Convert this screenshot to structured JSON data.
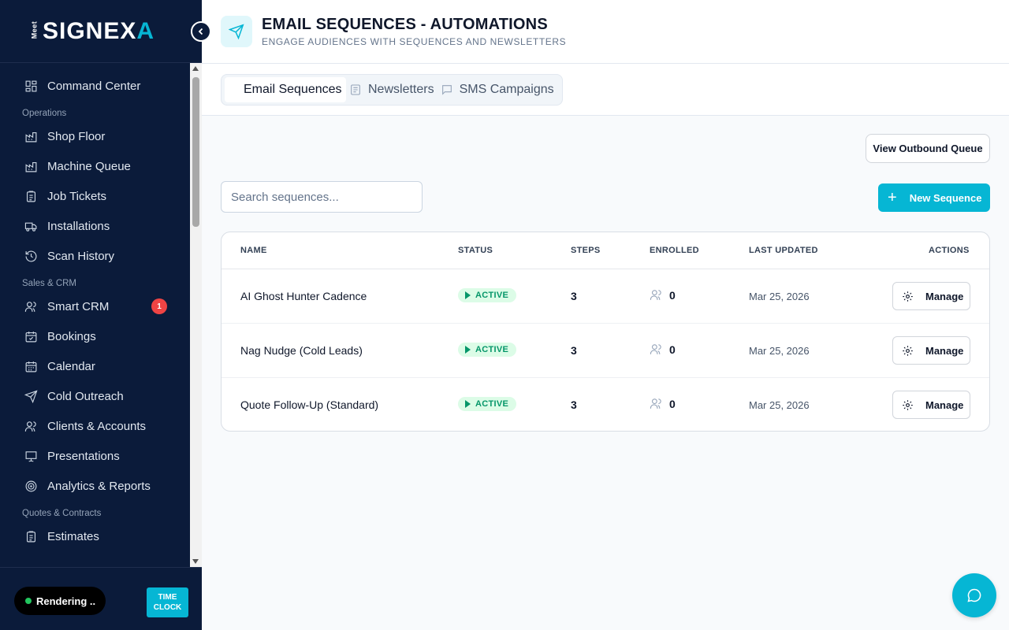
{
  "brand": {
    "meet": "Meet",
    "logo_a": "SIGNE",
    "logo_b": "X",
    "logo_c": "A"
  },
  "sidebar": {
    "items": [
      {
        "type": "item",
        "label": "Command Center",
        "icon": "dashboard-icon"
      },
      {
        "type": "section",
        "label": "Operations"
      },
      {
        "type": "item",
        "label": "Shop Floor",
        "icon": "factory-icon"
      },
      {
        "type": "item",
        "label": "Machine Queue",
        "icon": "factory-icon"
      },
      {
        "type": "item",
        "label": "Job Tickets",
        "icon": "clipboard-icon"
      },
      {
        "type": "item",
        "label": "Installations",
        "icon": "truck-icon"
      },
      {
        "type": "item",
        "label": "Scan History",
        "icon": "history-icon"
      },
      {
        "type": "section",
        "label": "Sales & CRM"
      },
      {
        "type": "item",
        "label": "Smart CRM",
        "icon": "users-icon",
        "badge": "1"
      },
      {
        "type": "item",
        "label": "Bookings",
        "icon": "calendar-check-icon"
      },
      {
        "type": "item",
        "label": "Calendar",
        "icon": "calendar-icon"
      },
      {
        "type": "item",
        "label": "Cold Outreach",
        "icon": "send-icon"
      },
      {
        "type": "item",
        "label": "Clients & Accounts",
        "icon": "users-icon"
      },
      {
        "type": "item",
        "label": "Presentations",
        "icon": "presentation-icon"
      },
      {
        "type": "item",
        "label": "Analytics & Reports",
        "icon": "target-icon"
      },
      {
        "type": "section",
        "label": "Quotes & Contracts"
      },
      {
        "type": "item",
        "label": "Estimates",
        "icon": "clipboard-icon"
      }
    ],
    "footer": {
      "rendering_label": "Rendering ..",
      "time_clock_line1": "TIME",
      "time_clock_line2": "CLOCK"
    }
  },
  "header": {
    "title": "EMAIL SEQUENCES - AUTOMATIONS",
    "subtitle": "ENGAGE AUDIENCES WITH SEQUENCES AND NEWSLETTERS"
  },
  "tabs": [
    {
      "label": "Email Sequences",
      "active": true
    },
    {
      "label": "Newsletters",
      "icon": "newspaper-icon"
    },
    {
      "label": "SMS Campaigns",
      "icon": "message-icon"
    }
  ],
  "toolbar": {
    "outbound_queue_label": "View Outbound Queue",
    "search_placeholder": "Search sequences...",
    "new_sequence_label": "New Sequence"
  },
  "table": {
    "columns": [
      "NAME",
      "STATUS",
      "STEPS",
      "ENROLLED",
      "LAST UPDATED",
      "ACTIONS"
    ],
    "rows": [
      {
        "name": "AI Ghost Hunter Cadence",
        "status": "ACTIVE",
        "steps": "3",
        "enrolled": "0",
        "updated": "Mar 25, 2026",
        "action": "Manage"
      },
      {
        "name": "Nag Nudge (Cold Leads)",
        "status": "ACTIVE",
        "steps": "3",
        "enrolled": "0",
        "updated": "Mar 25, 2026",
        "action": "Manage"
      },
      {
        "name": "Quote Follow-Up (Standard)",
        "status": "ACTIVE",
        "steps": "3",
        "enrolled": "0",
        "updated": "Mar 25, 2026",
        "action": "Manage"
      }
    ]
  },
  "colors": {
    "sidebar_bg": "#0b1b3a",
    "accent": "#06b6d4",
    "status_bg": "#dcfce7",
    "status_text": "#059669",
    "badge": "#ef4444"
  }
}
